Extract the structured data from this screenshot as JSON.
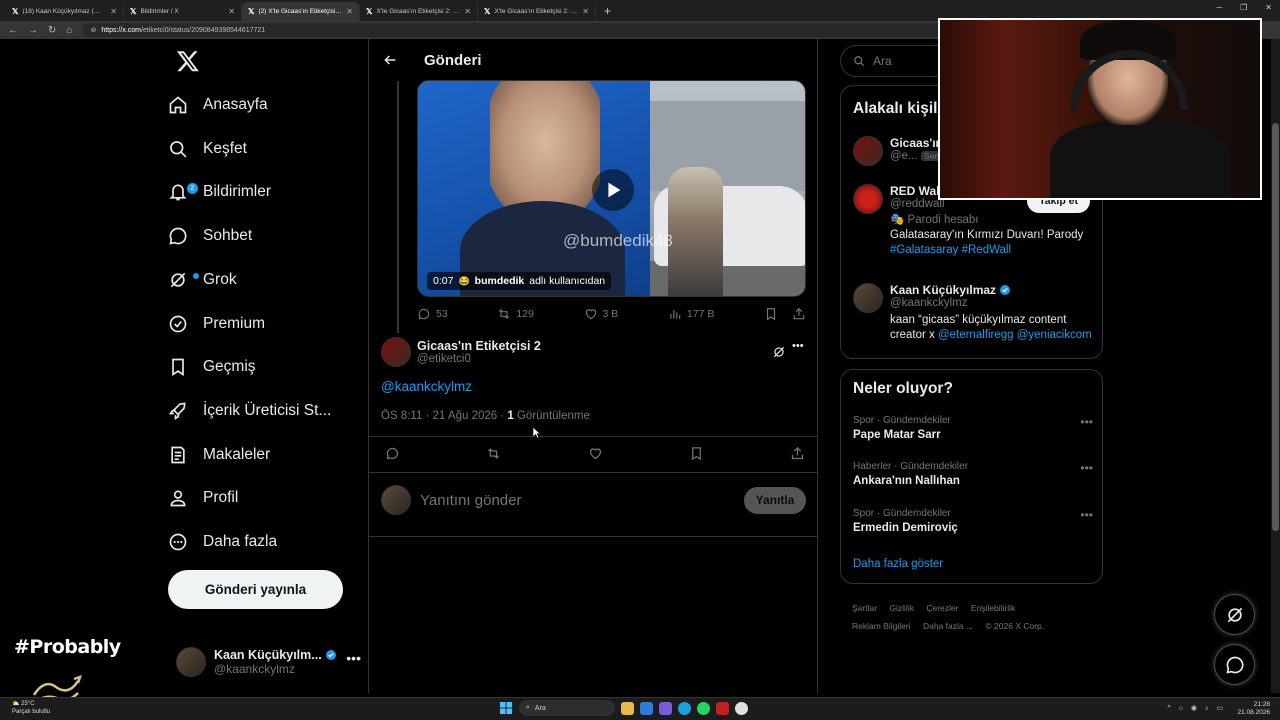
{
  "browser": {
    "tabs": [
      {
        "title": "(18) Kaan Küçükyılmaz (@kaankc"
      },
      {
        "title": "Bildirimler / X"
      },
      {
        "title": "(2) X'te Gicaas'ın Etiketçisi 2: \"@ka"
      },
      {
        "title": "X'te Gicaas'ın Etiketçisi 2: \"@equi"
      },
      {
        "title": "X'te Gicaas'ın Etiketçisi 2: \"@vubb"
      }
    ],
    "url_domain": "https://x.com",
    "url_path": "/etiketci0/status/2090849398544617721"
  },
  "nav": {
    "items": [
      {
        "label": "Anasayfa"
      },
      {
        "label": "Keşfet"
      },
      {
        "label": "Bildirimler",
        "badge": "2"
      },
      {
        "label": "Sohbet"
      },
      {
        "label": "Grok"
      },
      {
        "label": "Premium"
      },
      {
        "label": "Geçmiş"
      },
      {
        "label": "İçerik Üreticisi St..."
      },
      {
        "label": "Makaleler"
      },
      {
        "label": "Profil"
      },
      {
        "label": "Daha fazla"
      }
    ],
    "post_button": "Gönderi yayınla",
    "account": {
      "name": "Kaan Küçükyılm...",
      "handle": "@kaankckylmz"
    }
  },
  "main": {
    "header_title": "Gönderi",
    "video": {
      "watermark": "@bumdedik48",
      "time": "0:07",
      "credit_user": "bumdedik",
      "credit_suffix": "adlı kullanıcıdan"
    },
    "quoted_actions": {
      "replies": "53",
      "reposts": "129",
      "likes": "3 B",
      "views": "177 B"
    },
    "tweet": {
      "author_name": "Gicaas'ın Etiketçisi 2",
      "author_handle": "@etiketci0",
      "body": "@kaankckylmz",
      "timestamp": "ÖS 8:11 · 21 Ağu 2026 · ",
      "views_count": "1",
      "views_label": " Görüntülenme"
    },
    "reply_placeholder": "Yanıtını gönder",
    "reply_button": "Yanıtla"
  },
  "right": {
    "search_placeholder": "Ara",
    "related_title": "Alakalı kişil",
    "people": [
      {
        "name": "Gicaas'ın",
        "handle": "@e...",
        "tag": "Seni"
      },
      {
        "name": "RED Wall",
        "handle": "@reddwall",
        "parody": "Parodi hesabı",
        "bio": "Galatasaray'ın Kırmızı Duvarı! Parody ",
        "hashtags": "#Galatasaray #RedWall",
        "follow": "Takip et"
      },
      {
        "name": "Kaan Küçükyılmaz",
        "handle": "@kaankckylmz",
        "bio": "kaan “gicaas” küçükyılmaz content creator x ",
        "links": "@eternalfiregg @yeniacikcom"
      }
    ],
    "trends_title": "Neler oluyor?",
    "trends": [
      {
        "category": "Spor · Gündemdekiler",
        "name": "Pape Matar Sarr"
      },
      {
        "category": "Haberler · Gündemdekiler",
        "name": "Ankara'nın Nallıhan"
      },
      {
        "category": "Spor · Gündemdekiler",
        "name": "Ermedin Demiroviç"
      }
    ],
    "show_more": "Daha fazla göster",
    "footer": [
      "Şartlar",
      "Gizlilik",
      "Çerezler",
      "Erişilebilirlik",
      "Reklam Bilgileri",
      "Daha fazla ...",
      "© 2026 X Corp."
    ]
  },
  "overlay": {
    "brand_text": "#Probably"
  },
  "taskbar": {
    "weather_temp": "25°C",
    "weather_desc": "Parçalı bulutlu",
    "search": "Ara",
    "time": "21:28",
    "date": "21.08.2026"
  },
  "colors": {
    "accent": "#1d9bf0",
    "border": "#2f3336",
    "muted": "#71767b",
    "text": "#e7e9ea"
  }
}
